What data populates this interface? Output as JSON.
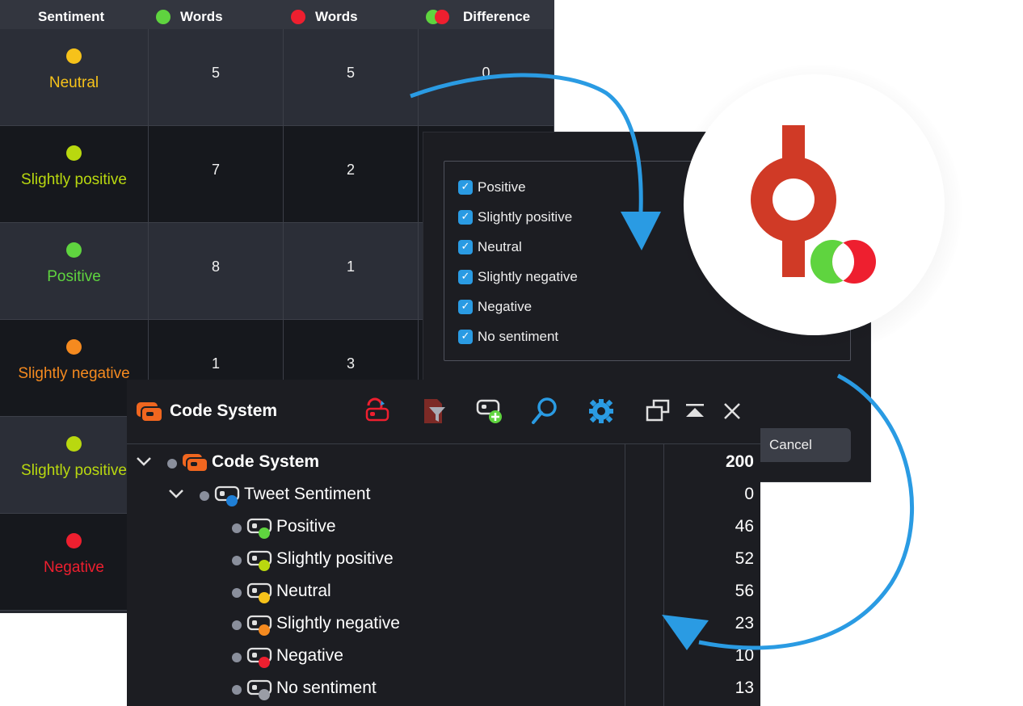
{
  "colors": {
    "green": "#5fd43f",
    "yellow_green": "#b9d80f",
    "yellow": "#f6c21a",
    "orange": "#f58a1f",
    "red": "#ee1f2f",
    "blue_accent": "#2a9be3",
    "arrow_blue": "#2a9be3",
    "logo_red": "#d03a26"
  },
  "sentiment_table": {
    "headers": {
      "sentiment": "Sentiment",
      "words_green": "Words",
      "words_red": "Words",
      "difference": "Difference"
    },
    "rows": [
      {
        "label": "Neutral",
        "color": "#f6c21a",
        "green_words": "5",
        "red_words": "5",
        "difference": "0"
      },
      {
        "label": "Slightly positive",
        "color": "#b9d80f",
        "green_words": "7",
        "red_words": "2",
        "difference": ""
      },
      {
        "label": "Positive",
        "color": "#5fd43f",
        "green_words": "8",
        "red_words": "1",
        "difference": ""
      },
      {
        "label": "Slightly negative",
        "color": "#f58a1f",
        "green_words": "1",
        "red_words": "3",
        "difference": ""
      },
      {
        "label": "Slightly positive",
        "color": "#b9d80f",
        "green_words": "",
        "red_words": "",
        "difference": ""
      },
      {
        "label": "Negative",
        "color": "#ee1f2f",
        "green_words": "",
        "red_words": "",
        "difference": ""
      }
    ]
  },
  "filter_dialog": {
    "options": [
      {
        "label": "Positive",
        "checked": true
      },
      {
        "label": "Slightly positive",
        "checked": true
      },
      {
        "label": "Neutral",
        "checked": true
      },
      {
        "label": "Slightly negative",
        "checked": true
      },
      {
        "label": "Negative",
        "checked": true
      },
      {
        "label": "No sentiment",
        "checked": true
      }
    ],
    "check_glyph": "✓",
    "cancel_label": "Cancel"
  },
  "code_system": {
    "title": "Code System",
    "toolbar_icons": [
      "code-reset-icon",
      "filter-codes-icon",
      "new-code-icon",
      "search-icon",
      "settings-icon",
      "undock-window-icon",
      "collapse-up-icon",
      "close-icon"
    ],
    "tree": [
      {
        "label": "Code System",
        "count": "200",
        "level": 0,
        "expanded": true,
        "color": "#f0661f"
      },
      {
        "label": "Tweet Sentiment",
        "count": "0",
        "level": 1,
        "expanded": true,
        "color": "#1f7fd6"
      },
      {
        "label": "Positive",
        "count": "46",
        "level": 2,
        "color": "#5fd43f"
      },
      {
        "label": "Slightly positive",
        "count": "52",
        "level": 2,
        "color": "#b9d80f"
      },
      {
        "label": "Neutral",
        "count": "56",
        "level": 2,
        "color": "#f6c21a"
      },
      {
        "label": "Slightly negative",
        "count": "23",
        "level": 2,
        "color": "#f58a1f"
      },
      {
        "label": "Negative",
        "count": "10",
        "level": 2,
        "color": "#ee1f2f"
      },
      {
        "label": "No sentiment",
        "count": "13",
        "level": 2,
        "color": "#9a9da6"
      }
    ]
  }
}
